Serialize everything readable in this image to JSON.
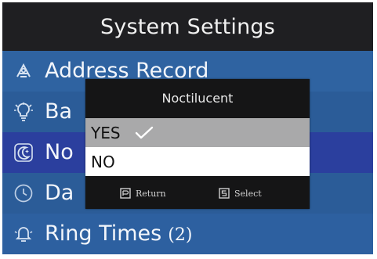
{
  "header": {
    "title": "System Settings"
  },
  "menu": {
    "items": [
      {
        "label": "Address Record",
        "icon": "address-book-icon"
      },
      {
        "label": "Ba",
        "icon": "lightbulb-icon"
      },
      {
        "label": "No",
        "icon": "moon-icon",
        "selected": true
      },
      {
        "label": "Da",
        "icon": "clock-icon"
      },
      {
        "label": "Ring Times",
        "count": "(2)",
        "icon": "bell-icon"
      }
    ]
  },
  "dialog": {
    "title": "Noctilucent",
    "options": [
      {
        "label": "YES",
        "checked": true
      },
      {
        "label": "NO",
        "checked": false
      }
    ],
    "footer": {
      "return_label": "Return",
      "select_label": "Select"
    }
  },
  "colors": {
    "title_bar": "#1f1f22",
    "menu_bg": "#2c5e97",
    "selected_row": "#2b3f9e",
    "dialog_bg": "#151516",
    "option_highlight": "#a9a9aa",
    "option_normal": "#ffffff"
  }
}
